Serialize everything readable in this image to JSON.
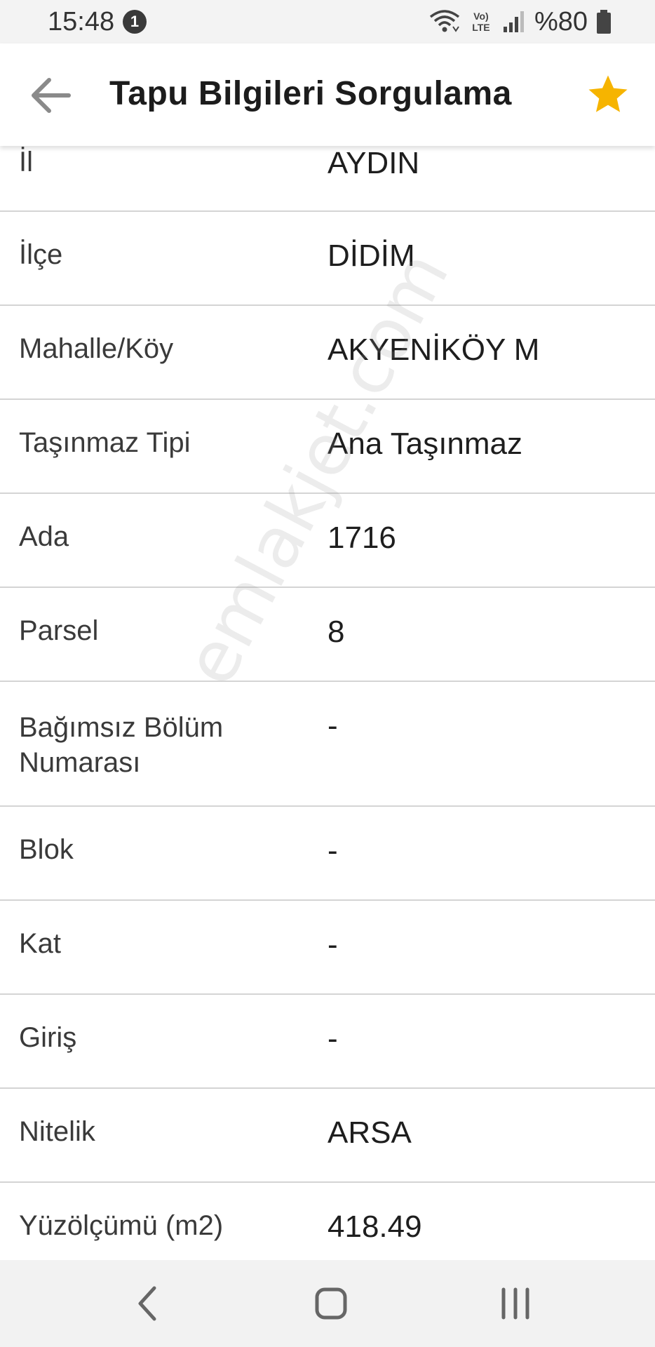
{
  "status_bar": {
    "time": "15:48",
    "notification_count": "1",
    "network_label": "Vo) LTE",
    "battery": "%80"
  },
  "app_bar": {
    "title": "Tapu Bilgileri Sorgulama",
    "back_icon": "arrow-left-icon",
    "favorite_icon": "star-icon",
    "favorite_color": "#F6B400"
  },
  "rows": [
    {
      "label": "İl",
      "value": "AYDIN"
    },
    {
      "label": "İlçe",
      "value": "DİDİM"
    },
    {
      "label": "Mahalle/Köy",
      "value": "AKYENİKÖY M"
    },
    {
      "label": "Taşınmaz Tipi",
      "value": "Ana Taşınmaz"
    },
    {
      "label": "Ada",
      "value": "1716"
    },
    {
      "label": "Parsel",
      "value": "8"
    },
    {
      "label": "Bağımsız Bölüm Numarası",
      "value": "-"
    },
    {
      "label": "Blok",
      "value": "-"
    },
    {
      "label": "Kat",
      "value": "-"
    },
    {
      "label": "Giriş",
      "value": "-"
    },
    {
      "label": "Nitelik",
      "value": "ARSA"
    },
    {
      "label": "Yüzölçümü (m2)",
      "value": "418.49"
    }
  ],
  "watermark": "emlakjet.com",
  "nav_bar": {
    "back_icon": "nav-back-icon",
    "home_icon": "nav-home-icon",
    "recents_icon": "nav-recents-icon"
  }
}
